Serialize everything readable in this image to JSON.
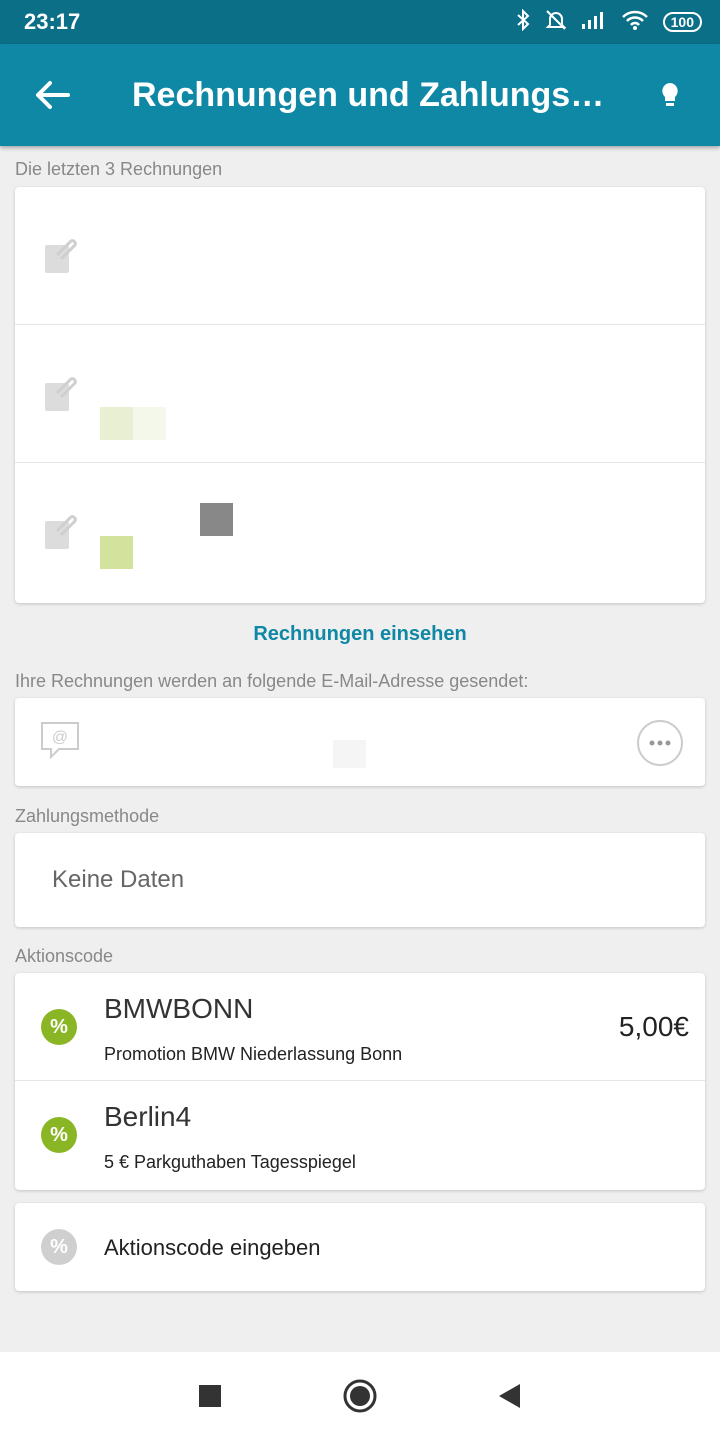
{
  "status_bar": {
    "time": "23:17",
    "battery": "100"
  },
  "app_bar": {
    "title": "Rechnungen und Zahlungsdet…"
  },
  "invoices": {
    "section_label": "Die letzten 3 Rechnungen",
    "link": "Rechnungen einsehen"
  },
  "email": {
    "section_label": "Ihre Rechnungen werden an folgende E-Mail-Adresse gesendet:"
  },
  "payment": {
    "section_label": "Zahlungsmethode",
    "value": "Keine Daten"
  },
  "promo": {
    "section_label": "Aktionscode",
    "items": [
      {
        "code": "BMWBONN",
        "description": "Promotion BMW Niederlassung Bonn",
        "amount": "5,00€"
      },
      {
        "code": "Berlin4",
        "description": "5 € Parkguthaben Tagesspiegel"
      }
    ],
    "enter_label": "Aktionscode eingeben",
    "icon_symbol": "%"
  },
  "colors": {
    "primary": "#0e88a4",
    "status_bar": "#0a6f87",
    "promo_green": "#8ab524"
  }
}
